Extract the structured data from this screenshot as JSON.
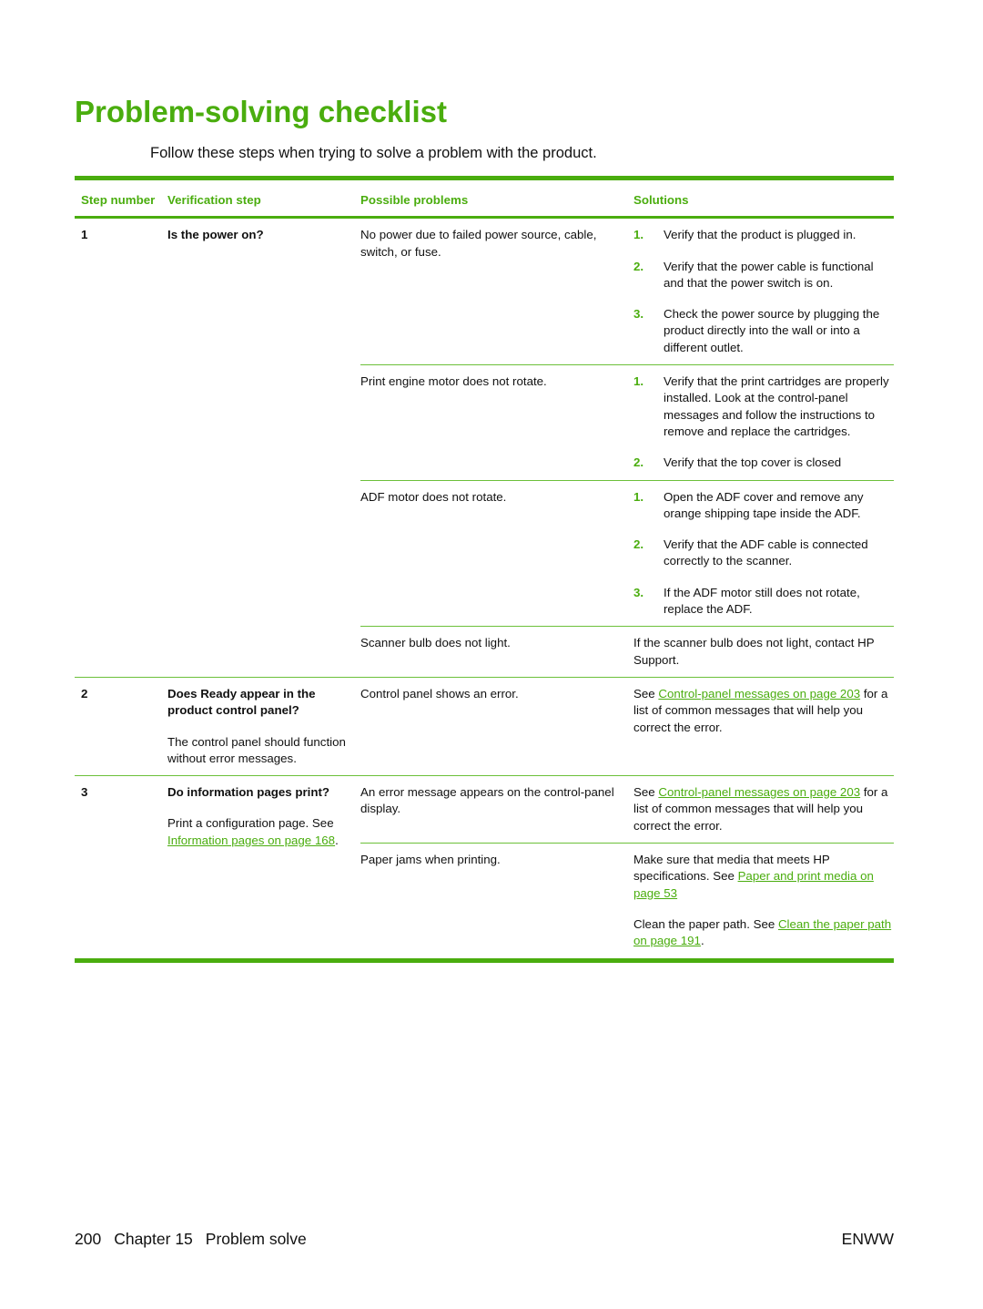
{
  "page": {
    "title": "Problem-solving checklist",
    "intro": "Follow these steps when trying to solve a problem with the product."
  },
  "table": {
    "headers": {
      "step": "Step number",
      "verification": "Verification step",
      "problems": "Possible problems",
      "solutions": "Solutions"
    },
    "rows": [
      {
        "step": "1",
        "verification_title": "Is the power on?",
        "problems": [
          {
            "problem": "No power due to failed power source, cable, switch, or fuse.",
            "solutions": [
              {
                "num": "1.",
                "text": "Verify that the product is plugged in."
              },
              {
                "num": "2.",
                "text": "Verify that the power cable is functional and that the power switch is on."
              },
              {
                "num": "3.",
                "text": "Check the power source by plugging the product directly into the wall or into a different outlet."
              }
            ]
          },
          {
            "problem": "Print engine motor does not rotate.",
            "solutions": [
              {
                "num": "1.",
                "text": "Verify that the print cartridges are properly installed. Look at the control-panel messages and follow the instructions to remove and replace the cartridges."
              },
              {
                "num": "2.",
                "text": "Verify that the top cover is closed"
              }
            ]
          },
          {
            "problem": "ADF motor does not rotate.",
            "solutions": [
              {
                "num": "1.",
                "text": "Open the ADF cover and remove any orange shipping tape inside the ADF."
              },
              {
                "num": "2.",
                "text": "Verify that the ADF cable is connected correctly to the scanner."
              },
              {
                "num": "3.",
                "text": "If the ADF motor still does not rotate, replace the ADF."
              }
            ]
          },
          {
            "problem": "Scanner bulb does not light.",
            "solution_text": "If the scanner bulb does not light, contact HP Support."
          }
        ]
      },
      {
        "step": "2",
        "verification_title": "Does Ready appear in the product control panel?",
        "verification_note": "The control panel should function without error messages.",
        "problems": [
          {
            "problem": "Control panel shows an error.",
            "solution_prefix": "See ",
            "solution_link": "Control-panel messages on page 203",
            "solution_suffix": " for a list of common messages that will help you correct the error."
          }
        ]
      },
      {
        "step": "3",
        "verification_title": "Do information pages print?",
        "verification_note_prefix": "Print a configuration page. See ",
        "verification_link": "Information pages on page 168",
        "verification_note_suffix": ".",
        "problems": [
          {
            "problem": "An error message appears on the control-panel display.",
            "solution_prefix": "See ",
            "solution_link": "Control-panel messages on page 203",
            "solution_suffix": " for a list of common messages that will help you correct the error."
          },
          {
            "problem": "Paper jams when printing.",
            "solution_p1_prefix": "Make sure that media that meets HP specifications. See ",
            "solution_p1_link": "Paper and print media on page 53",
            "solution_p2_prefix": "Clean the paper path. See ",
            "solution_p2_link": "Clean the paper path on page 191",
            "solution_p2_suffix": "."
          }
        ]
      }
    ]
  },
  "footer": {
    "page_number": "200",
    "chapter": "Chapter 15",
    "chapter_title": "Problem solve",
    "locale": "ENWW"
  }
}
